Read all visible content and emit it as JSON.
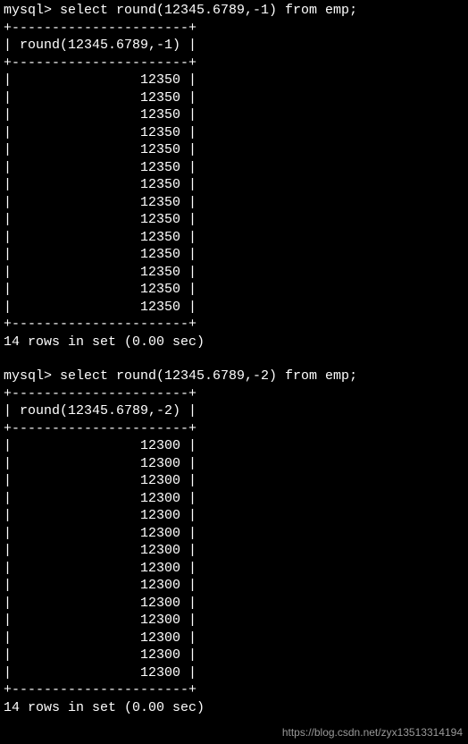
{
  "query1": {
    "prompt": "mysql> select round(12345.6789,-1) from emp;",
    "border": "+----------------------+",
    "header": "| round(12345.6789,-1) |",
    "rows": [
      "|                12350 |",
      "|                12350 |",
      "|                12350 |",
      "|                12350 |",
      "|                12350 |",
      "|                12350 |",
      "|                12350 |",
      "|                12350 |",
      "|                12350 |",
      "|                12350 |",
      "|                12350 |",
      "|                12350 |",
      "|                12350 |",
      "|                12350 |"
    ],
    "result": "14 rows in set (0.00 sec)"
  },
  "query2": {
    "prompt": "mysql> select round(12345.6789,-2) from emp;",
    "border": "+----------------------+",
    "header": "| round(12345.6789,-2) |",
    "rows": [
      "|                12300 |",
      "|                12300 |",
      "|                12300 |",
      "|                12300 |",
      "|                12300 |",
      "|                12300 |",
      "|                12300 |",
      "|                12300 |",
      "|                12300 |",
      "|                12300 |",
      "|                12300 |",
      "|                12300 |",
      "|                12300 |",
      "|                12300 |"
    ],
    "result": "14 rows in set (0.00 sec)"
  },
  "watermark": "https://blog.csdn.net/zyx13513314194"
}
